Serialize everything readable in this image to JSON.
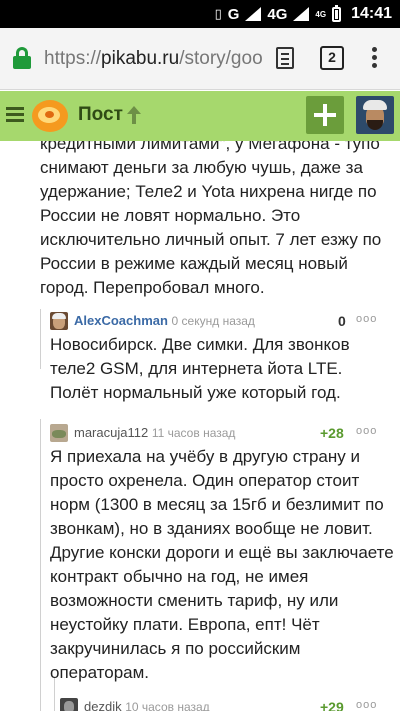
{
  "status_bar": {
    "network_label": "G",
    "network_4g": "4G",
    "network_4g_small": "4G",
    "time": "14:41",
    "icons": [
      "vibrate-icon",
      "network-g-icon",
      "signal-icon",
      "signal-4g-icon",
      "battery-icon"
    ]
  },
  "browser": {
    "url_scheme": "https://",
    "url_host": "pikabu.ru",
    "url_path": "/story/goo",
    "tab_count": "2"
  },
  "header": {
    "title": "Пост",
    "accent": "#a6d86d"
  },
  "comments": [
    {
      "author": "",
      "text": "кредитными лимитами\", у Мегафона - тупо снимают деньги за любую чушь, даже за удержание; Теле2 и Yota нихрена нигде по России не ловят нормально. Это исключительно личный опыт. 7 лет езжу по России в режиме каждый месяц новый город. Перепробовал много."
    },
    {
      "author": "AlexCoachman",
      "author_color": "#3b6aa6",
      "time": "0 секунд назад",
      "rating": "0",
      "rating_color": "#333333",
      "text": "Новосибирск. Две симки. Для звонков теле2 GSM, для интернета йота LTE. Полёт нормальный уже который год."
    },
    {
      "author": "maracuja112",
      "author_color": "#555555",
      "time": "11 часов назад",
      "rating": "+28",
      "rating_color": "#5a9a2f",
      "text": "Я приехала на учёбу в другую страну и просто охренела. Один оператор стоит норм (1300 в месяц за 15гб и безлимит по звонкам), но в зданиях вообще не ловит. Другие конски дороги и ещё вы заключаете контракт обычно на год, не имея возможности сменить тариф, ну или неустойку плати. Европа, епт! Чёт закручинилась я по российским операторам."
    },
    {
      "author": "dezdik",
      "author_color": "#555555",
      "time": "10 часов назад",
      "rating": "+29",
      "rating_color": "#5a9a2f"
    }
  ],
  "more_icon": "ooo"
}
